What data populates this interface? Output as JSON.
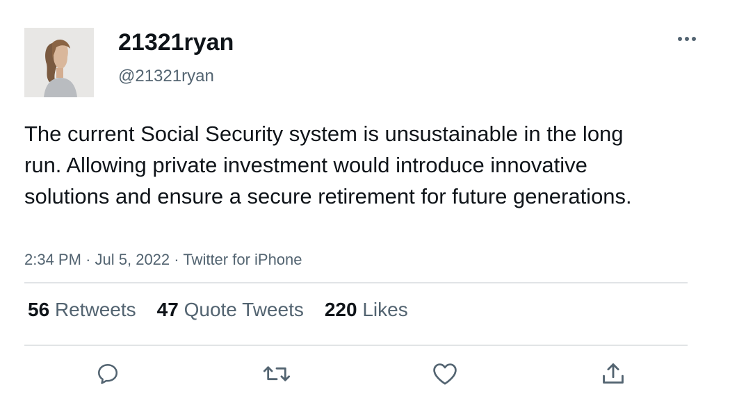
{
  "author": {
    "display_name": "21321ryan",
    "handle": "@21321ryan"
  },
  "tweet": {
    "text": "The current Social Security system is unsustainable in the long run. Allowing private investment would introduce innovative solutions and ensure a secure retirement for future generations.",
    "time": "2:34 PM",
    "date": "Jul 5, 2022",
    "source": "Twitter for iPhone",
    "separator": "·"
  },
  "stats": {
    "retweets_count": "56",
    "retweets_label": "Retweets",
    "quotes_count": "47",
    "quotes_label": "Quote Tweets",
    "likes_count": "220",
    "likes_label": "Likes"
  },
  "icons": {
    "more": "more-dots-icon",
    "reply": "reply-icon",
    "retweet": "retweet-icon",
    "like": "heart-icon",
    "share": "share-icon"
  },
  "colors": {
    "text": "#0f1419",
    "secondary": "#536471",
    "divider": "#e1e4e6"
  }
}
